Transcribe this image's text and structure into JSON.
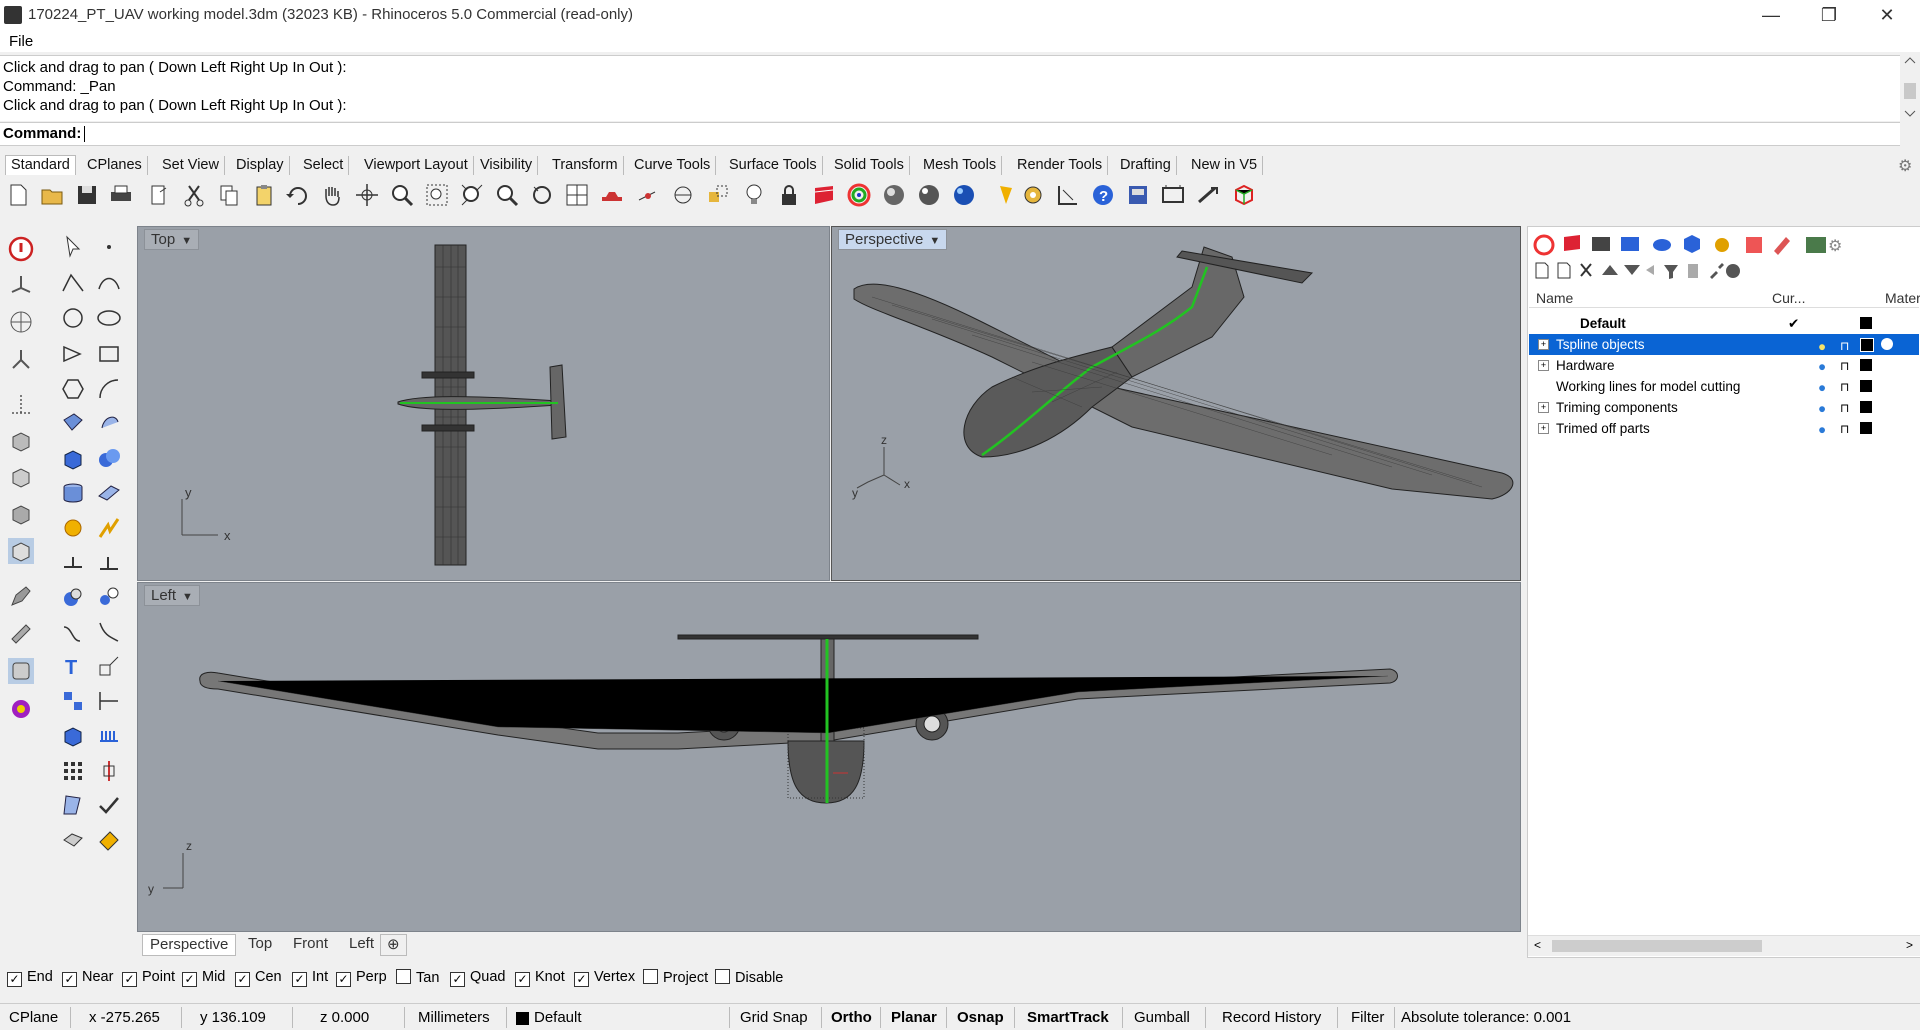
{
  "window": {
    "title": "170224_PT_UAV working model.3dm (32023 KB) - Rhinoceros 5.0 Commercial (read-only)",
    "minimize": "—",
    "maximize": "❐",
    "close": "✕"
  },
  "menu": {
    "file": "File"
  },
  "history": {
    "line1": "Click and drag to pan ( Down  Left  Right  Up  In  Out ):",
    "line2": "Command: _Pan",
    "line3": "Click and drag to pan ( Down  Left  Right  Up  In  Out ):"
  },
  "command": {
    "label": "Command:"
  },
  "tabs": [
    "Standard",
    "CPlanes",
    "Set View",
    "Display",
    "Select",
    "Viewport Layout",
    "Visibility",
    "Transform",
    "Curve Tools",
    "Surface Tools",
    "Solid Tools",
    "Mesh Tools",
    "Render Tools",
    "Drafting",
    "New in V5"
  ],
  "viewports": {
    "top": "Top",
    "perspective": "Perspective",
    "left": "Left"
  },
  "axes": {
    "x": "x",
    "y": "y",
    "z": "z"
  },
  "viewport_tabs": [
    "Perspective",
    "Top",
    "Front",
    "Left"
  ],
  "layers": {
    "col_name": "Name",
    "col_current": "Cur...",
    "col_material": "Materi",
    "rows": [
      {
        "name": "Default",
        "current": "✔"
      },
      {
        "name": "Tspline objects"
      },
      {
        "name": "Hardware"
      },
      {
        "name": "Working lines for model cutting"
      },
      {
        "name": "Triming components"
      },
      {
        "name": "Trimed off parts"
      }
    ]
  },
  "osnaps": [
    {
      "label": "End",
      "checked": true
    },
    {
      "label": "Near",
      "checked": true
    },
    {
      "label": "Point",
      "checked": true
    },
    {
      "label": "Mid",
      "checked": true
    },
    {
      "label": "Cen",
      "checked": true
    },
    {
      "label": "Int",
      "checked": true
    },
    {
      "label": "Perp",
      "checked": true
    },
    {
      "label": "Tan",
      "checked": false
    },
    {
      "label": "Quad",
      "checked": true
    },
    {
      "label": "Knot",
      "checked": true
    },
    {
      "label": "Vertex",
      "checked": true
    },
    {
      "label": "Project",
      "checked": false
    },
    {
      "label": "Disable",
      "checked": false
    }
  ],
  "status": {
    "cplane": "CPlane",
    "x": "x -275.265",
    "y": "y 136.109",
    "z": "z 0.000",
    "units": "Millimeters",
    "layer": "Default",
    "grid_snap": "Grid Snap",
    "ortho": "Ortho",
    "planar": "Planar",
    "osnap": "Osnap",
    "smarttrack": "SmartTrack",
    "gumball": "Gumball",
    "record_history": "Record History",
    "filter": "Filter",
    "tolerance": "Absolute tolerance: 0.001"
  },
  "colors": {
    "selection": "#0a64d4",
    "viewport_bg": "#9aa0a8",
    "curve_green": "#22c322"
  }
}
